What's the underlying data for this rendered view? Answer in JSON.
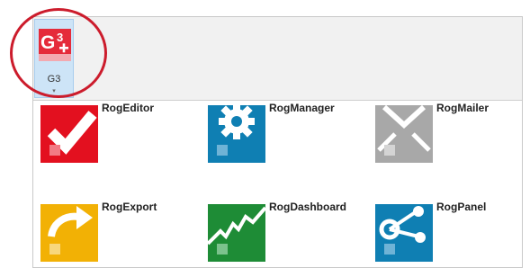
{
  "ribbon": {
    "g3_button": {
      "label": "G3",
      "icon": "g3-logo-icon",
      "caret": "▾"
    }
  },
  "apps": [
    {
      "label": "RogEditor",
      "icon": "checkmark-icon",
      "color": "#e3101f"
    },
    {
      "label": "RogManager",
      "icon": "gear-icon",
      "color": "#0f7fb3"
    },
    {
      "label": "RogMailer",
      "icon": "envelope-icon",
      "color": "#a8a8a8"
    },
    {
      "label": "RogExport",
      "icon": "export-arrow-icon",
      "color": "#f2b105"
    },
    {
      "label": "RogDashboard",
      "icon": "chart-line-icon",
      "color": "#1e8c36"
    },
    {
      "label": "RogPanel",
      "icon": "share-nodes-icon",
      "color": "#0f7fb3"
    }
  ],
  "colors": {
    "highlight": "#cc1c2c",
    "g3_brand": "#e52b3a",
    "selected_bg": "#cde4f7"
  }
}
